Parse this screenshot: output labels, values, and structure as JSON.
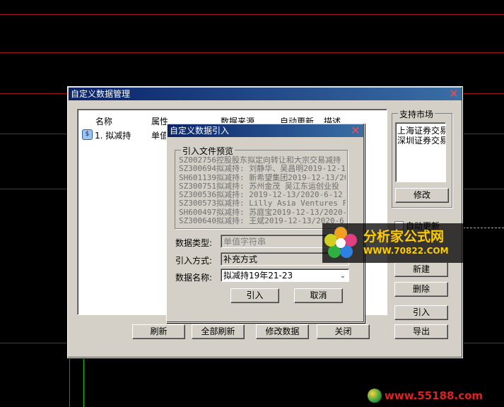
{
  "main_dialog": {
    "title": "自定义数据管理",
    "columns": [
      "名称",
      "属性",
      "数据来源",
      "自动更新",
      "描述"
    ],
    "rows": [
      {
        "name": "1. 拟减持",
        "attr": "单值"
      }
    ],
    "market_label": "支持市场",
    "markets": [
      "上海证券交易",
      "深圳证券交易"
    ],
    "modify_label": "修改",
    "auto_update_label": "自动更新",
    "new_label": "新建",
    "delete_label": "删除",
    "import_label": "引入",
    "export_label": "导出",
    "refresh_label": "刷新",
    "refresh_all_label": "全部刷新",
    "edit_data_label": "修改数据",
    "close_label": "关闭"
  },
  "import_dialog": {
    "title": "自定义数据引入",
    "preview_label": "引入文件预览",
    "preview_lines": [
      "SZ002756控股股东拟定向转让和大宗交易减持",
      "SZ300694拟减持: 刘静华、吴昌明2019-12-1",
      "SH601139拟减持: 新希望集团2019-12-13/20",
      "SZ300751拟减持: 苏州金茂 吴江东运创业投",
      "SZ300536拟减持: 2019-12-13/2020-6-12 (7",
      "SZ300573拟减持: Lilly Asia Ventures Fun",
      "SH600497拟减持: 苏庭宝2019-12-13/2020-6",
      "SZ300640拟减持: 王斌2019-12-13/2020-6-1"
    ],
    "type_label": "数据类型:",
    "type_value": "单值字符串",
    "method_label": "引入方式:",
    "method_value": "补充方式",
    "name_label": "数据名称:",
    "name_value": "拟减持19年21-23",
    "import_btn": "引入",
    "cancel_btn": "取消"
  },
  "watermarks": {
    "brand_top": "分析家公式网",
    "url_top": "WWW.70822.COM",
    "url_bottom": "www.55188.com"
  },
  "colors": {
    "bg": "#000000",
    "grid_line": "#a0151a",
    "dialog_face": "#d4d0c8",
    "titlebar": "#0a246a",
    "watermark_text": "#ffcc00"
  }
}
